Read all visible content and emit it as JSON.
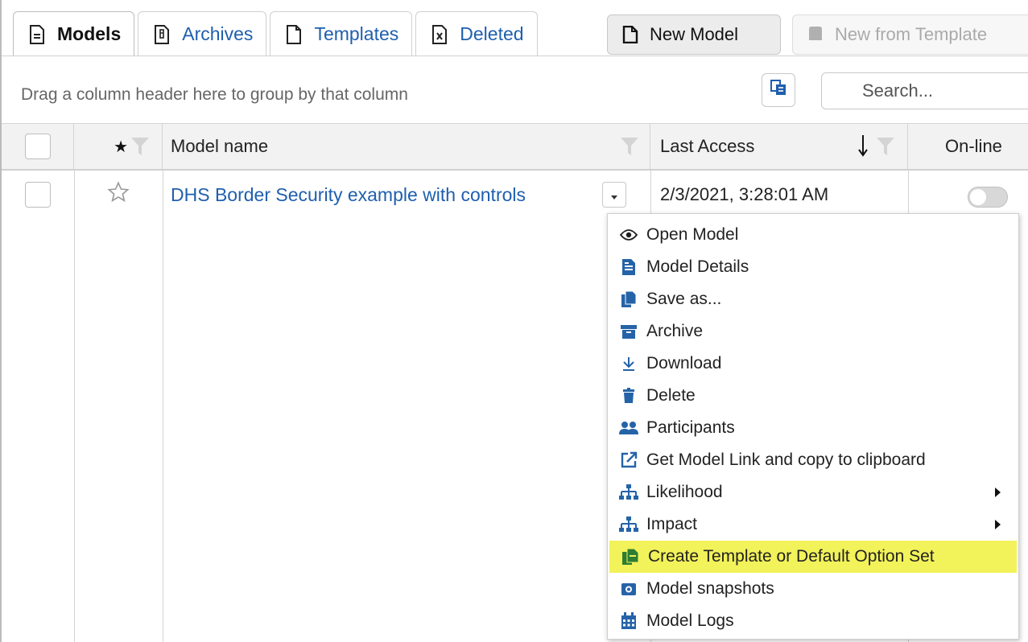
{
  "tabs": [
    {
      "label": "Models",
      "icon": "document-icon",
      "active": true
    },
    {
      "label": "Archives",
      "icon": "archive-file-icon"
    },
    {
      "label": "Templates",
      "icon": "template-file-icon"
    },
    {
      "label": "Deleted",
      "icon": "deleted-file-icon"
    }
  ],
  "toolbar": {
    "new_model_label": "New Model",
    "new_from_template_label": "New from Template",
    "group_hint": "Drag a column header here to group by that column",
    "search_placeholder": "Search..."
  },
  "grid": {
    "columns": {
      "star": "★",
      "name": "Model name",
      "last_access": "Last Access",
      "online": "On-line"
    },
    "rows": [
      {
        "name": "DHS Border Security example with controls",
        "last_access": "2/3/2021, 3:28:01 AM",
        "online": false,
        "favorite": false
      }
    ]
  },
  "menu": {
    "items": [
      {
        "label": "Open Model",
        "icon": "eye-icon"
      },
      {
        "label": "Model Details",
        "icon": "details-icon"
      },
      {
        "label": "Save as...",
        "icon": "copy-icon"
      },
      {
        "label": "Archive",
        "icon": "archive-box-icon"
      },
      {
        "label": "Download",
        "icon": "download-icon"
      },
      {
        "label": "Delete",
        "icon": "trash-icon"
      },
      {
        "label": "Participants",
        "icon": "users-icon"
      },
      {
        "label": "Get Model Link and copy to clipboard",
        "icon": "external-link-icon"
      },
      {
        "label": "Likelihood",
        "icon": "hierarchy-icon",
        "submenu": true
      },
      {
        "label": "Impact",
        "icon": "hierarchy-icon",
        "submenu": true
      },
      {
        "label": "Create Template or Default Option Set",
        "icon": "template-green-icon",
        "highlighted": true
      },
      {
        "label": "Model snapshots",
        "icon": "camera-icon"
      },
      {
        "label": "Model Logs",
        "icon": "calendar-icon"
      }
    ]
  },
  "colors": {
    "link": "#1f5fae",
    "highlight": "#f2f25a",
    "icon_blue": "#2563a8",
    "icon_green": "#2e7d32"
  }
}
